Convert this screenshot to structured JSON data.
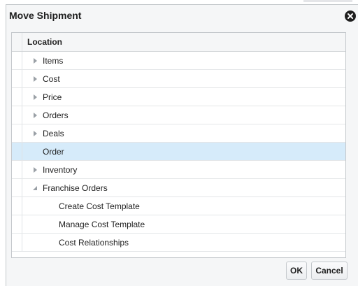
{
  "dialog": {
    "title": "Move Shipment",
    "ok_label": "OK",
    "cancel_label": "Cancel"
  },
  "tree": {
    "column_header": "Location",
    "rows": [
      {
        "label": "Items",
        "expandable": true,
        "expanded": false,
        "selected": false
      },
      {
        "label": "Cost",
        "expandable": true,
        "expanded": false,
        "selected": false
      },
      {
        "label": "Price",
        "expandable": true,
        "expanded": false,
        "selected": false
      },
      {
        "label": "Orders",
        "expandable": true,
        "expanded": false,
        "selected": false
      },
      {
        "label": "Deals",
        "expandable": true,
        "expanded": false,
        "selected": false
      },
      {
        "label": "Order",
        "expandable": false,
        "expanded": false,
        "selected": true
      },
      {
        "label": "Inventory",
        "expandable": true,
        "expanded": false,
        "selected": false
      },
      {
        "label": "Franchise Orders",
        "expandable": true,
        "expanded": true,
        "selected": false
      },
      {
        "label": "Create Cost Template",
        "expandable": false,
        "expanded": false,
        "selected": false
      },
      {
        "label": "Manage Cost Template",
        "expandable": false,
        "expanded": false,
        "selected": false
      },
      {
        "label": "Cost Relationships",
        "expandable": false,
        "expanded": false,
        "selected": false
      }
    ]
  },
  "colors": {
    "selected_row": "#d6ebfa",
    "dialog_bg": "#f5f6f7",
    "border": "#c4c8cc"
  },
  "icons": {
    "close": "close-icon",
    "collapsed": "caret-right-icon",
    "expanded": "caret-down-icon"
  }
}
